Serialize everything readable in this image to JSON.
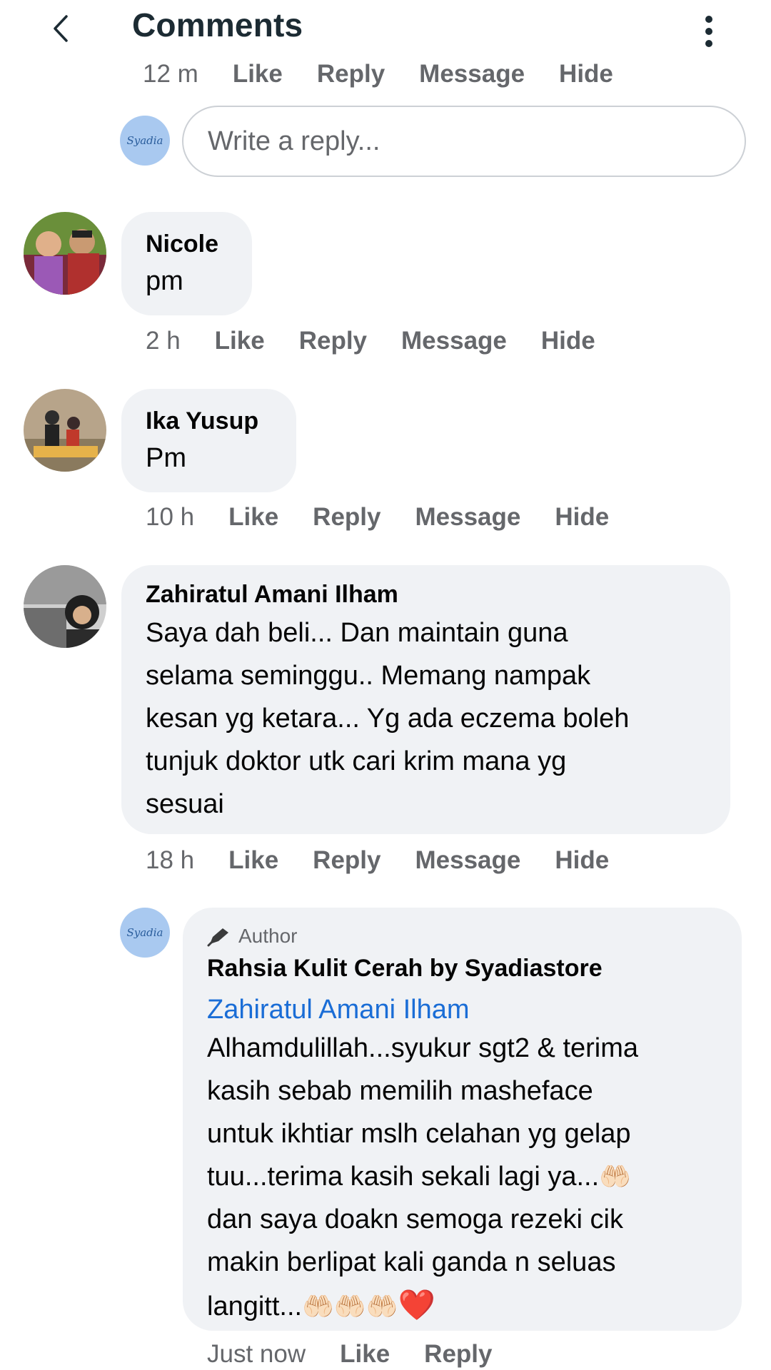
{
  "header": {
    "title": "Comments"
  },
  "top_actions": {
    "time": "12 m",
    "like": "Like",
    "reply": "Reply",
    "message": "Message",
    "hide": "Hide"
  },
  "reply_box": {
    "avatar_text": "Syadia",
    "placeholder": "Write a reply..."
  },
  "comments": [
    {
      "name": "Nicole",
      "text": "pm",
      "time": "2 h",
      "like": "Like",
      "reply": "Reply",
      "message": "Message",
      "hide": "Hide"
    },
    {
      "name": "Ika Yusup",
      "text": "Pm",
      "time": "10 h",
      "like": "Like",
      "reply": "Reply",
      "message": "Message",
      "hide": "Hide"
    },
    {
      "name": "Zahiratul Amani Ilham",
      "text_lines": [
        "Saya dah beli... Dan maintain guna",
        "selama seminggu.. Memang nampak",
        "kesan yg ketara... Yg ada eczema boleh",
        "tunjuk doktor utk cari krim mana yg",
        "sesuai"
      ],
      "time": "18 h",
      "like": "Like",
      "reply": "Reply",
      "message": "Message",
      "hide": "Hide"
    }
  ],
  "author_reply": {
    "avatar_text": "Syadia",
    "badge": "Author",
    "name": "Rahsia Kulit Cerah by Syadiastore",
    "mention": "Zahiratul Amani Ilham",
    "text_lines": [
      "Alhamdulillah...syukur sgt2 & terima",
      "kasih sebab memilih masheface",
      "untuk ikhtiar mslh celahan yg gelap",
      "tuu...terima kasih sekali lagi ya...",
      "dan saya doakn semoga rezeki cik",
      "makin berlipat kali ganda n seluas",
      "langitt..."
    ],
    "emoji_hands": "🤲🏻",
    "emoji_heart": "❤️",
    "time": "Just now",
    "like": "Like",
    "reply": "Reply"
  },
  "colors": {
    "meta_gray": "#65676b",
    "bubble_bg": "#f0f2f5",
    "link_blue": "#1a6dd6"
  }
}
